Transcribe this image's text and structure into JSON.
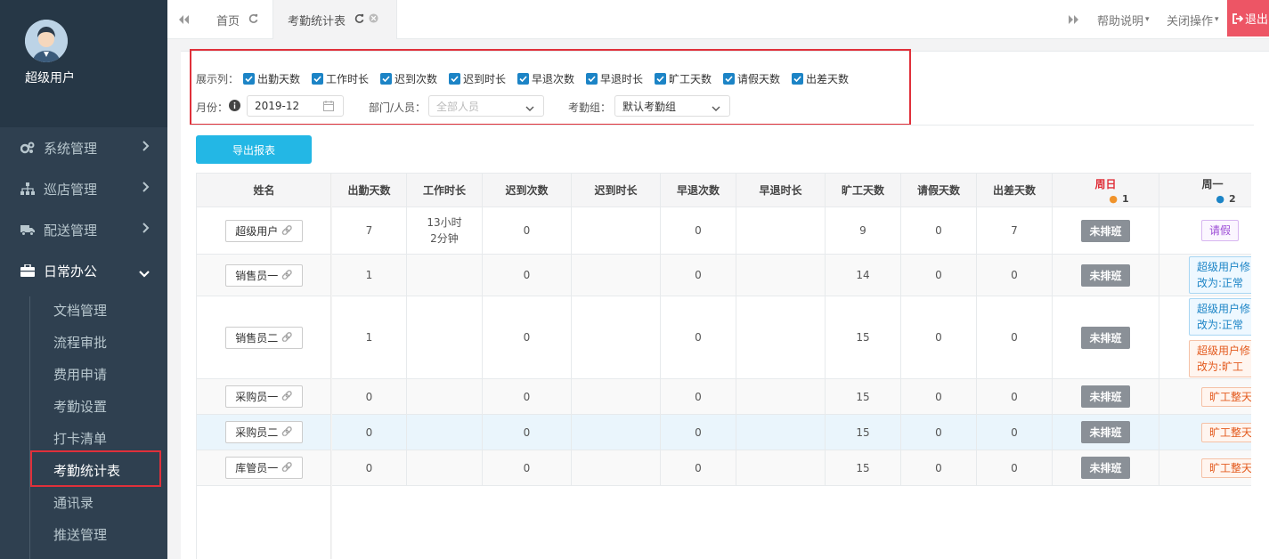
{
  "sidebar": {
    "username": "超级用户",
    "menu": [
      {
        "label": "系统管理",
        "icon": "gears-icon"
      },
      {
        "label": "巡店管理",
        "icon": "sitemap-icon"
      },
      {
        "label": "配送管理",
        "icon": "truck-icon"
      },
      {
        "label": "日常办公",
        "icon": "briefcase-icon"
      }
    ],
    "submenu": [
      "文档管理",
      "流程审批",
      "费用申请",
      "考勤设置",
      "打卡清单",
      "考勤统计表",
      "通讯录",
      "推送管理"
    ]
  },
  "tabs": {
    "home": "首页",
    "active": "考勤统计表",
    "help": "帮助说明",
    "close_ops": "关闭操作",
    "logout": "退出"
  },
  "filters": {
    "show_cols_label": "展示列：",
    "columns": [
      "出勤天数",
      "工作时长",
      "迟到次数",
      "迟到时长",
      "早退次数",
      "早退时长",
      "旷工天数",
      "请假天数",
      "出差天数"
    ],
    "month_label": "月份：",
    "month_value": "2019-12",
    "dept_label": "部门/人员：",
    "dept_placeholder": "全部人员",
    "group_label": "考勤组：",
    "group_value": "默认考勤组"
  },
  "export_button": "导出报表",
  "table": {
    "headers": [
      "姓名",
      "出勤天数",
      "工作时长",
      "迟到次数",
      "迟到时长",
      "早退次数",
      "早退时长",
      "旷工天数",
      "请假天数",
      "出差天数"
    ],
    "day_cols": [
      {
        "label": "周日",
        "num": "1",
        "color": "#e0303a",
        "dot": "#f0932b"
      },
      {
        "label": "周一",
        "num": "2",
        "color": "#333333",
        "dot": "#1c84c6"
      }
    ],
    "rows": [
      {
        "name": "超级用户",
        "cells": [
          "7",
          "13小时2分钟",
          "0",
          "",
          "0",
          "",
          "9",
          "0",
          "7"
        ],
        "sun": "未排班",
        "mon": [
          {
            "text": "请假",
            "style": "purple"
          }
        ]
      },
      {
        "name": "销售员一",
        "cells": [
          "1",
          "",
          "0",
          "",
          "0",
          "",
          "14",
          "0",
          "0"
        ],
        "sun": "未排班",
        "mon": [
          {
            "text": "超级用户修改为:正常",
            "style": "blue"
          }
        ]
      },
      {
        "name": "销售员二",
        "cells": [
          "1",
          "",
          "0",
          "",
          "0",
          "",
          "15",
          "0",
          "0"
        ],
        "sun": "未排班",
        "mon": [
          {
            "text": "超级用户修改为:正常",
            "style": "blue"
          },
          {
            "text": "超级用户修改为:旷工",
            "style": "orange"
          }
        ]
      },
      {
        "name": "采购员一",
        "cells": [
          "0",
          "",
          "0",
          "",
          "0",
          "",
          "15",
          "0",
          "0"
        ],
        "sun": "未排班",
        "mon": [
          {
            "text": "旷工整天",
            "style": "orange"
          }
        ]
      },
      {
        "name": "采购员二",
        "cells": [
          "0",
          "",
          "0",
          "",
          "0",
          "",
          "15",
          "0",
          "0"
        ],
        "sun": "未排班",
        "mon": [
          {
            "text": "旷工整天",
            "style": "orange"
          }
        ]
      },
      {
        "name": "库管员一",
        "cells": [
          "0",
          "",
          "0",
          "",
          "0",
          "",
          "15",
          "0",
          "0"
        ],
        "sun": "未排班",
        "mon": [
          {
            "text": "旷工整天",
            "style": "orange"
          }
        ]
      }
    ]
  }
}
